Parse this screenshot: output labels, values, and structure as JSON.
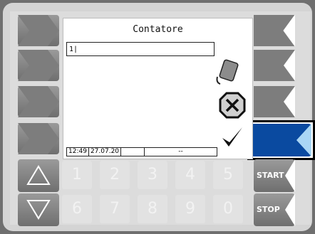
{
  "screen": {
    "title": "Contatore",
    "input_value": "1|",
    "status": {
      "time": "12:49",
      "date": "27.07.20",
      "field3": "",
      "field4": "--"
    }
  },
  "keypad": {
    "keys_row1": [
      "1",
      "2",
      "3",
      "4",
      "5"
    ],
    "keys_row2": [
      "6",
      "7",
      "8",
      "9",
      "0"
    ]
  },
  "side_buttons": {
    "start_label": "START",
    "stop_label": "STOP"
  },
  "icons": [
    "eraser-icon",
    "cancel-icon",
    "confirm-checkmark-icon"
  ],
  "colors": {
    "active_button": "#0a4aa0",
    "active_button_tip": "#a9d6f5"
  }
}
